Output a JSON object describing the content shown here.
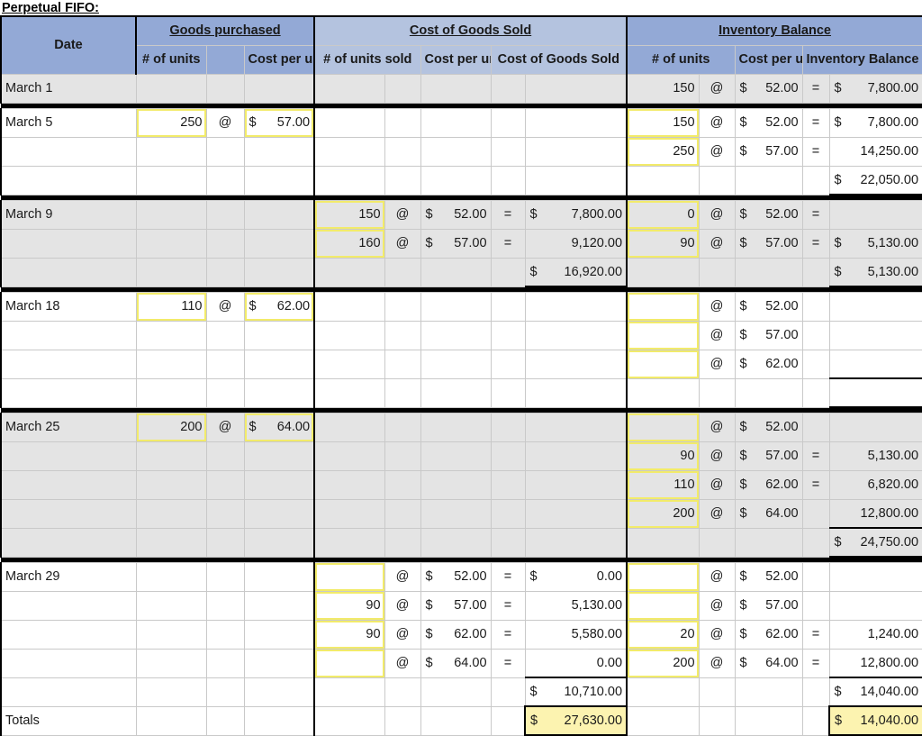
{
  "title": "Perpetual FIFO:",
  "colors": {
    "header_dark": "#93A9D6",
    "header_light": "#B4C3DF",
    "row_gray": "#E4E4E4",
    "input_outline": "#F2EB6A",
    "answer_fill": "#FCF3B0"
  },
  "header": {
    "groups": {
      "date": "Date",
      "goods_purchased": "Goods purchased",
      "cost_of_goods_sold": "Cost of Goods Sold",
      "inventory_balance": "Inventory Balance"
    },
    "sub": {
      "gp_units": "# of units",
      "gp_cost": "Cost per unit",
      "cogs_units": "# of units sold",
      "cogs_cost": "Cost per unit",
      "cogs_total": "Cost of Goods Sold",
      "inv_units": "# of units",
      "inv_cost": "Cost per unit",
      "inv_balance": "Inventory Balance"
    }
  },
  "symbols": {
    "at": "@",
    "eq": "=",
    "dollar": "$"
  },
  "rows": [
    {
      "id": "march-1",
      "date": "March 1",
      "shade": "gray",
      "lines": [
        {
          "gp": {
            "units": "",
            "at": "",
            "cost_sym": "",
            "cost": ""
          },
          "cogs": {
            "units": "",
            "at": "",
            "cost_sym": "",
            "cost": "",
            "eq": "",
            "total_sym": "",
            "total": ""
          },
          "inv": {
            "units": "150",
            "at": "@",
            "cost_sym": "$",
            "cost": "52.00",
            "eq": "=",
            "bal_sym": "$",
            "bal": "7,800.00"
          }
        }
      ]
    },
    {
      "id": "march-5",
      "date": "March 5",
      "shade": "white",
      "lines": [
        {
          "gp": {
            "units": "250",
            "units_input": true,
            "at": "@",
            "cost_sym": "$",
            "cost": "57.00",
            "cost_input": true
          },
          "cogs": {
            "units": "",
            "at": "",
            "cost_sym": "",
            "cost": "",
            "eq": "",
            "total_sym": "",
            "total": ""
          },
          "inv": {
            "units": "150",
            "units_input": true,
            "at": "@",
            "cost_sym": "$",
            "cost": "52.00",
            "eq": "=",
            "bal_sym": "$",
            "bal": "7,800.00"
          }
        },
        {
          "gp": {
            "units": "",
            "at": "",
            "cost_sym": "",
            "cost": ""
          },
          "cogs": {
            "units": "",
            "at": "",
            "cost_sym": "",
            "cost": "",
            "eq": "",
            "total_sym": "",
            "total": ""
          },
          "inv": {
            "units": "250",
            "units_input": true,
            "at": "@",
            "cost_sym": "$",
            "cost": "57.00",
            "eq": "=",
            "bal_sym": "",
            "bal": "14,250.00"
          }
        },
        {
          "gp": {
            "units": "",
            "at": "",
            "cost_sym": "",
            "cost": ""
          },
          "cogs": {
            "units": "",
            "at": "",
            "cost_sym": "",
            "cost": "",
            "eq": "",
            "total_sym": "",
            "total": ""
          },
          "inv": {
            "units": "",
            "at": "",
            "cost_sym": "",
            "cost": "",
            "eq": "",
            "bal_sym": "$",
            "bal": "22,050.00",
            "bal_subtotal": true
          }
        }
      ]
    },
    {
      "id": "march-9",
      "date": "March 9",
      "shade": "gray",
      "lines": [
        {
          "gp": {
            "units": "",
            "at": "",
            "cost_sym": "",
            "cost": ""
          },
          "cogs": {
            "units": "150",
            "units_input": true,
            "at": "@",
            "cost_sym": "$",
            "cost": "52.00",
            "eq": "=",
            "total_sym": "$",
            "total": "7,800.00"
          },
          "inv": {
            "units": "0",
            "units_input": true,
            "at": "@",
            "cost_sym": "$",
            "cost": "52.00",
            "eq": "=",
            "bal_sym": "",
            "bal": ""
          }
        },
        {
          "gp": {
            "units": "",
            "at": "",
            "cost_sym": "",
            "cost": ""
          },
          "cogs": {
            "units": "160",
            "units_input": true,
            "at": "@",
            "cost_sym": "$",
            "cost": "57.00",
            "eq": "=",
            "total_sym": "",
            "total": "9,120.00"
          },
          "inv": {
            "units": "90",
            "units_input": true,
            "at": "@",
            "cost_sym": "$",
            "cost": "57.00",
            "eq": "=",
            "bal_sym": "$",
            "bal": "5,130.00"
          }
        },
        {
          "gp": {
            "units": "",
            "at": "",
            "cost_sym": "",
            "cost": ""
          },
          "cogs": {
            "units": "",
            "at": "",
            "cost_sym": "",
            "cost": "",
            "eq": "",
            "total_sym": "$",
            "total": "16,920.00",
            "total_subtotal": true
          },
          "inv": {
            "units": "",
            "at": "",
            "cost_sym": "",
            "cost": "",
            "eq": "",
            "bal_sym": "$",
            "bal": "5,130.00",
            "bal_subtotal": true
          }
        }
      ]
    },
    {
      "id": "march-18",
      "date": "March 18",
      "shade": "white",
      "lines": [
        {
          "gp": {
            "units": "110",
            "units_input": true,
            "at": "@",
            "cost_sym": "$",
            "cost": "62.00",
            "cost_input": true
          },
          "cogs": {
            "units": "",
            "at": "",
            "cost_sym": "",
            "cost": "",
            "eq": "",
            "total_sym": "",
            "total": ""
          },
          "inv": {
            "units": "",
            "units_input": true,
            "at": "@",
            "cost_sym": "$",
            "cost": "52.00",
            "eq": "",
            "bal_sym": "",
            "bal": ""
          }
        },
        {
          "gp": {
            "units": "",
            "at": "",
            "cost_sym": "",
            "cost": ""
          },
          "cogs": {
            "units": "",
            "at": "",
            "cost_sym": "",
            "cost": "",
            "eq": "",
            "total_sym": "",
            "total": ""
          },
          "inv": {
            "units": "",
            "units_input": true,
            "at": "@",
            "cost_sym": "$",
            "cost": "57.00",
            "eq": "",
            "bal_sym": "",
            "bal": ""
          }
        },
        {
          "gp": {
            "units": "",
            "at": "",
            "cost_sym": "",
            "cost": ""
          },
          "cogs": {
            "units": "",
            "at": "",
            "cost_sym": "",
            "cost": "",
            "eq": "",
            "total_sym": "",
            "total": ""
          },
          "inv": {
            "units": "",
            "units_input": true,
            "at": "@",
            "cost_sym": "$",
            "cost": "62.00",
            "eq": "",
            "bal_sym": "",
            "bal": "",
            "bal_ruled": true
          }
        },
        {
          "gp": {
            "units": "",
            "at": "",
            "cost_sym": "",
            "cost": ""
          },
          "cogs": {
            "units": "",
            "at": "",
            "cost_sym": "",
            "cost": "",
            "eq": "",
            "total_sym": "",
            "total": ""
          },
          "inv": {
            "units": "",
            "at": "",
            "cost_sym": "",
            "cost": "",
            "eq": "",
            "bal_sym": "",
            "bal": "",
            "bal_subtotal": true
          }
        }
      ]
    },
    {
      "id": "march-25",
      "date": "March 25",
      "shade": "gray",
      "lines": [
        {
          "gp": {
            "units": "200",
            "units_input": true,
            "at": "@",
            "cost_sym": "$",
            "cost": "64.00",
            "cost_input": true
          },
          "cogs": {
            "units": "",
            "at": "",
            "cost_sym": "",
            "cost": "",
            "eq": "",
            "total_sym": "",
            "total": ""
          },
          "inv": {
            "units": "",
            "units_input": true,
            "at": "@",
            "cost_sym": "$",
            "cost": "52.00",
            "eq": "",
            "bal_sym": "",
            "bal": ""
          }
        },
        {
          "gp": {
            "units": "",
            "at": "",
            "cost_sym": "",
            "cost": ""
          },
          "cogs": {
            "units": "",
            "at": "",
            "cost_sym": "",
            "cost": "",
            "eq": "",
            "total_sym": "",
            "total": ""
          },
          "inv": {
            "units": "90",
            "units_input": true,
            "at": "@",
            "cost_sym": "$",
            "cost": "57.00",
            "eq": "=",
            "bal_sym": "",
            "bal": "5,130.00"
          }
        },
        {
          "gp": {
            "units": "",
            "at": "",
            "cost_sym": "",
            "cost": ""
          },
          "cogs": {
            "units": "",
            "at": "",
            "cost_sym": "",
            "cost": "",
            "eq": "",
            "total_sym": "",
            "total": ""
          },
          "inv": {
            "units": "110",
            "units_input": true,
            "at": "@",
            "cost_sym": "$",
            "cost": "62.00",
            "eq": "=",
            "bal_sym": "",
            "bal": "6,820.00"
          }
        },
        {
          "gp": {
            "units": "",
            "at": "",
            "cost_sym": "",
            "cost": ""
          },
          "cogs": {
            "units": "",
            "at": "",
            "cost_sym": "",
            "cost": "",
            "eq": "",
            "total_sym": "",
            "total": ""
          },
          "inv": {
            "units": "200",
            "units_input": true,
            "at": "@",
            "cost_sym": "$",
            "cost": "64.00",
            "eq": "",
            "bal_sym": "",
            "bal": "12,800.00",
            "bal_ruled": true
          }
        },
        {
          "gp": {
            "units": "",
            "at": "",
            "cost_sym": "",
            "cost": ""
          },
          "cogs": {
            "units": "",
            "at": "",
            "cost_sym": "",
            "cost": "",
            "eq": "",
            "total_sym": "",
            "total": ""
          },
          "inv": {
            "units": "",
            "at": "",
            "cost_sym": "",
            "cost": "",
            "eq": "",
            "bal_sym": "$",
            "bal": "24,750.00",
            "bal_subtotal": true
          }
        }
      ]
    },
    {
      "id": "march-29",
      "date": "March 29",
      "shade": "white",
      "lines": [
        {
          "gp": {
            "units": "",
            "at": "",
            "cost_sym": "",
            "cost": ""
          },
          "cogs": {
            "units": "",
            "units_input": true,
            "at": "@",
            "cost_sym": "$",
            "cost": "52.00",
            "eq": "=",
            "total_sym": "$",
            "total": "0.00"
          },
          "inv": {
            "units": "",
            "units_input": true,
            "at": "@",
            "cost_sym": "$",
            "cost": "52.00",
            "eq": "",
            "bal_sym": "",
            "bal": ""
          }
        },
        {
          "gp": {
            "units": "",
            "at": "",
            "cost_sym": "",
            "cost": ""
          },
          "cogs": {
            "units": "90",
            "units_input": true,
            "at": "@",
            "cost_sym": "$",
            "cost": "57.00",
            "eq": "=",
            "total_sym": "",
            "total": "5,130.00"
          },
          "inv": {
            "units": "",
            "units_input": true,
            "at": "@",
            "cost_sym": "$",
            "cost": "57.00",
            "eq": "",
            "bal_sym": "",
            "bal": ""
          }
        },
        {
          "gp": {
            "units": "",
            "at": "",
            "cost_sym": "",
            "cost": ""
          },
          "cogs": {
            "units": "90",
            "units_input": true,
            "at": "@",
            "cost_sym": "$",
            "cost": "62.00",
            "eq": "=",
            "total_sym": "",
            "total": "5,580.00"
          },
          "inv": {
            "units": "20",
            "units_input": true,
            "at": "@",
            "cost_sym": "$",
            "cost": "62.00",
            "eq": "=",
            "bal_sym": "",
            "bal": "1,240.00"
          }
        },
        {
          "gp": {
            "units": "",
            "at": "",
            "cost_sym": "",
            "cost": ""
          },
          "cogs": {
            "units": "",
            "units_input": true,
            "at": "@",
            "cost_sym": "$",
            "cost": "64.00",
            "eq": "=",
            "total_sym": "",
            "total": "0.00",
            "total_ruled": true
          },
          "inv": {
            "units": "200",
            "units_input": true,
            "at": "@",
            "cost_sym": "$",
            "cost": "64.00",
            "eq": "=",
            "bal_sym": "",
            "bal": "12,800.00",
            "bal_ruled": true
          }
        },
        {
          "gp": {
            "units": "",
            "at": "",
            "cost_sym": "",
            "cost": ""
          },
          "cogs": {
            "units": "",
            "at": "",
            "cost_sym": "",
            "cost": "",
            "eq": "",
            "total_sym": "$",
            "total": "10,710.00",
            "total_subtotal": true
          },
          "inv": {
            "units": "",
            "at": "",
            "cost_sym": "",
            "cost": "",
            "eq": "",
            "bal_sym": "$",
            "bal": "14,040.00",
            "bal_subtotal": true
          }
        }
      ]
    },
    {
      "id": "totals",
      "date": "Totals",
      "shade": "white",
      "no_separator_before": true,
      "lines": [
        {
          "gp": {
            "units": "",
            "at": "",
            "cost_sym": "",
            "cost": ""
          },
          "cogs": {
            "units": "",
            "at": "",
            "cost_sym": "",
            "cost": "",
            "eq": "",
            "total_sym": "$",
            "total": "27,630.00",
            "total_answer": true,
            "total_grand": true
          },
          "inv": {
            "units": "",
            "at": "",
            "cost_sym": "",
            "cost": "",
            "eq": "",
            "bal_sym": "$",
            "bal": "14,040.00",
            "bal_answer": true,
            "bal_grand": true
          }
        }
      ]
    }
  ]
}
